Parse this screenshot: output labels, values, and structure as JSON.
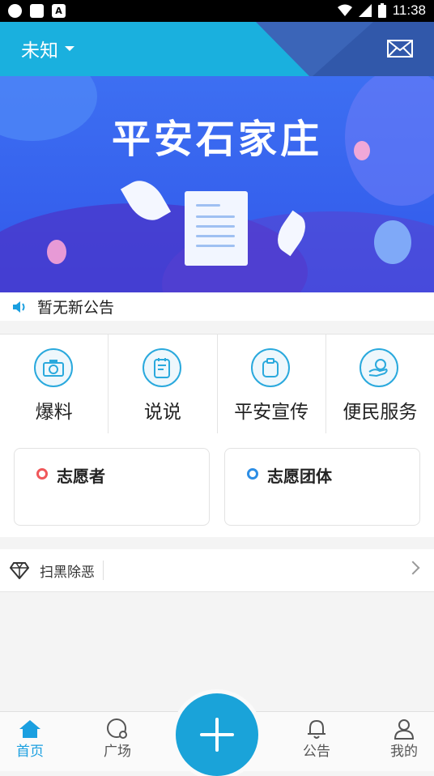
{
  "status_bar": {
    "time": "11:38"
  },
  "header": {
    "location": "未知"
  },
  "banner": {
    "title": "平安石家庄"
  },
  "notice": {
    "text": "暂无新公告"
  },
  "grid": [
    {
      "label": "爆料",
      "icon": "camera-icon"
    },
    {
      "label": "说说",
      "icon": "note-icon"
    },
    {
      "label": "平安宣传",
      "icon": "clipboard-icon"
    },
    {
      "label": "便民服务",
      "icon": "hand-service-icon"
    }
  ],
  "volunteer": [
    {
      "label": "志愿者",
      "color": "#f0575a"
    },
    {
      "label": "志愿团体",
      "color": "#2d8ee5"
    }
  ],
  "campaign": {
    "label": "扫黑除恶",
    "icon": "diamond-icon"
  },
  "tabs": [
    {
      "label": "首页",
      "icon": "home-icon",
      "active": true
    },
    {
      "label": "广场",
      "icon": "chat-bubble-icon"
    },
    {
      "label": "公告",
      "icon": "bell-icon"
    },
    {
      "label": "我的",
      "icon": "person-icon"
    }
  ],
  "colors": {
    "primary": "#1ab0de",
    "accent": "#1a9fe0",
    "header_dark": "#3b65b8",
    "banner": "#3d6ff2"
  }
}
